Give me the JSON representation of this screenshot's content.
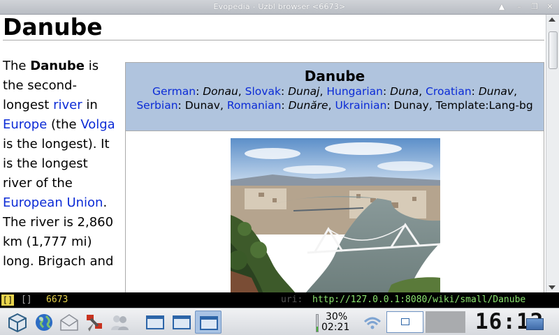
{
  "window": {
    "title": "Evopedia - Uzbl browser <6673>"
  },
  "article": {
    "title": "Danube",
    "intro": {
      "t1": "The ",
      "b1": "Danube",
      "t2": " is the second-longest ",
      "l1": "river",
      "t3": " in ",
      "l2": "Europe",
      "t4": " (the ",
      "l3": "Volga",
      "t5": " is the longest). It is the longest river of the ",
      "l4": "European Union",
      "t6": ". The river is 2,860 km (1,777 mi) long. Brigach and"
    },
    "infobox": {
      "title": "Danube",
      "languages": [
        {
          "name": "German",
          "word": "Donau",
          "italic": true
        },
        {
          "name": "Slovak",
          "word": "Dunaj",
          "italic": true
        },
        {
          "name": "Hungarian",
          "word": "Duna",
          "italic": true
        },
        {
          "name": "Croatian",
          "word": "Dunav",
          "italic": true
        },
        {
          "name": "Serbian",
          "word": "Dunav",
          "italic": false
        },
        {
          "name": "Romanian",
          "word": "Dunăre",
          "italic": true
        },
        {
          "name": "Ukrainian",
          "word": "Dunay",
          "italic": false
        }
      ],
      "template_note": "Template:Lang-bg"
    }
  },
  "statusbar": {
    "mode_active": "[]",
    "mode_inactive": "[]",
    "pid": "6673",
    "uri_label": "uri:",
    "uri": "http://127.0.0.1:8080/wiki/small/Danube"
  },
  "taskbar": {
    "battery_percent": "30%",
    "battery_level": 0.3,
    "battery_time": "02:21",
    "clock": "16:12"
  },
  "colors": {
    "link": "#0b2bd6",
    "infobox_header": "#b0c4de",
    "status_uri": "#8be36f",
    "status_pid": "#e8d44d"
  },
  "icons": [
    "cube-icon",
    "globe-icon",
    "mail-icon",
    "satellite-icon",
    "users-icon",
    "window-icon",
    "wifi-icon",
    "network-icon"
  ]
}
